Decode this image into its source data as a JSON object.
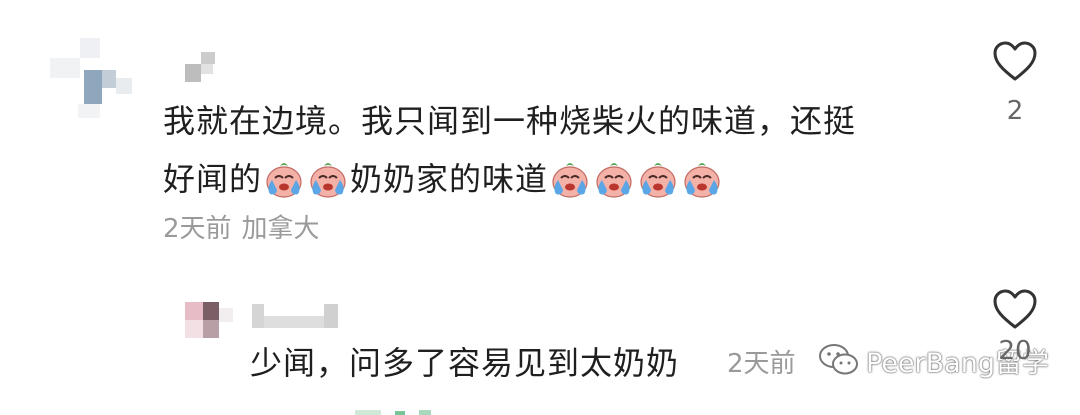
{
  "comment": {
    "line1": "我就在边境。我只闻到一种烧柴火的味道，还挺",
    "line2_part1": "好闻的",
    "line2_part2": "奶奶家的味道",
    "time": "2天前",
    "location": "加拿大",
    "likes": "2"
  },
  "reply": {
    "text": "少闻，问多了容易见到太奶奶",
    "time": "2天前",
    "likes": "20"
  },
  "emoji_name": "crying-face-emoji",
  "watermark": {
    "text": "PeerBang留学"
  },
  "colors": {
    "text": "#1f1f1f",
    "meta": "#9a9a9a",
    "heart_outline": "#333333",
    "emoji_face": "#f2a7a0",
    "emoji_tear": "#5aa6e6"
  }
}
